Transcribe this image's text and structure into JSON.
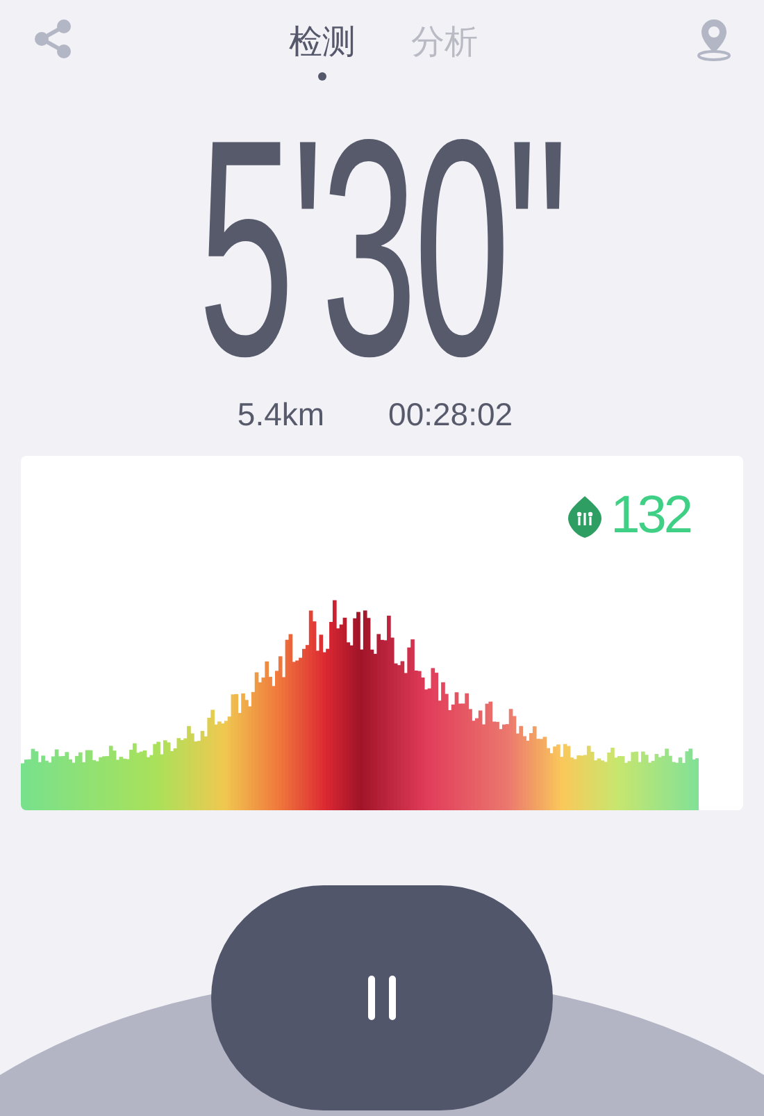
{
  "tabs": [
    {
      "label": "检测",
      "selected": true
    },
    {
      "label": "分析",
      "selected": false
    }
  ],
  "pace": "5'30\"",
  "stats": [
    {
      "value": "5.4km"
    },
    {
      "value": "00:28:02"
    }
  ],
  "heart_rate": {
    "value": "132"
  },
  "control": {
    "paused": false
  }
}
